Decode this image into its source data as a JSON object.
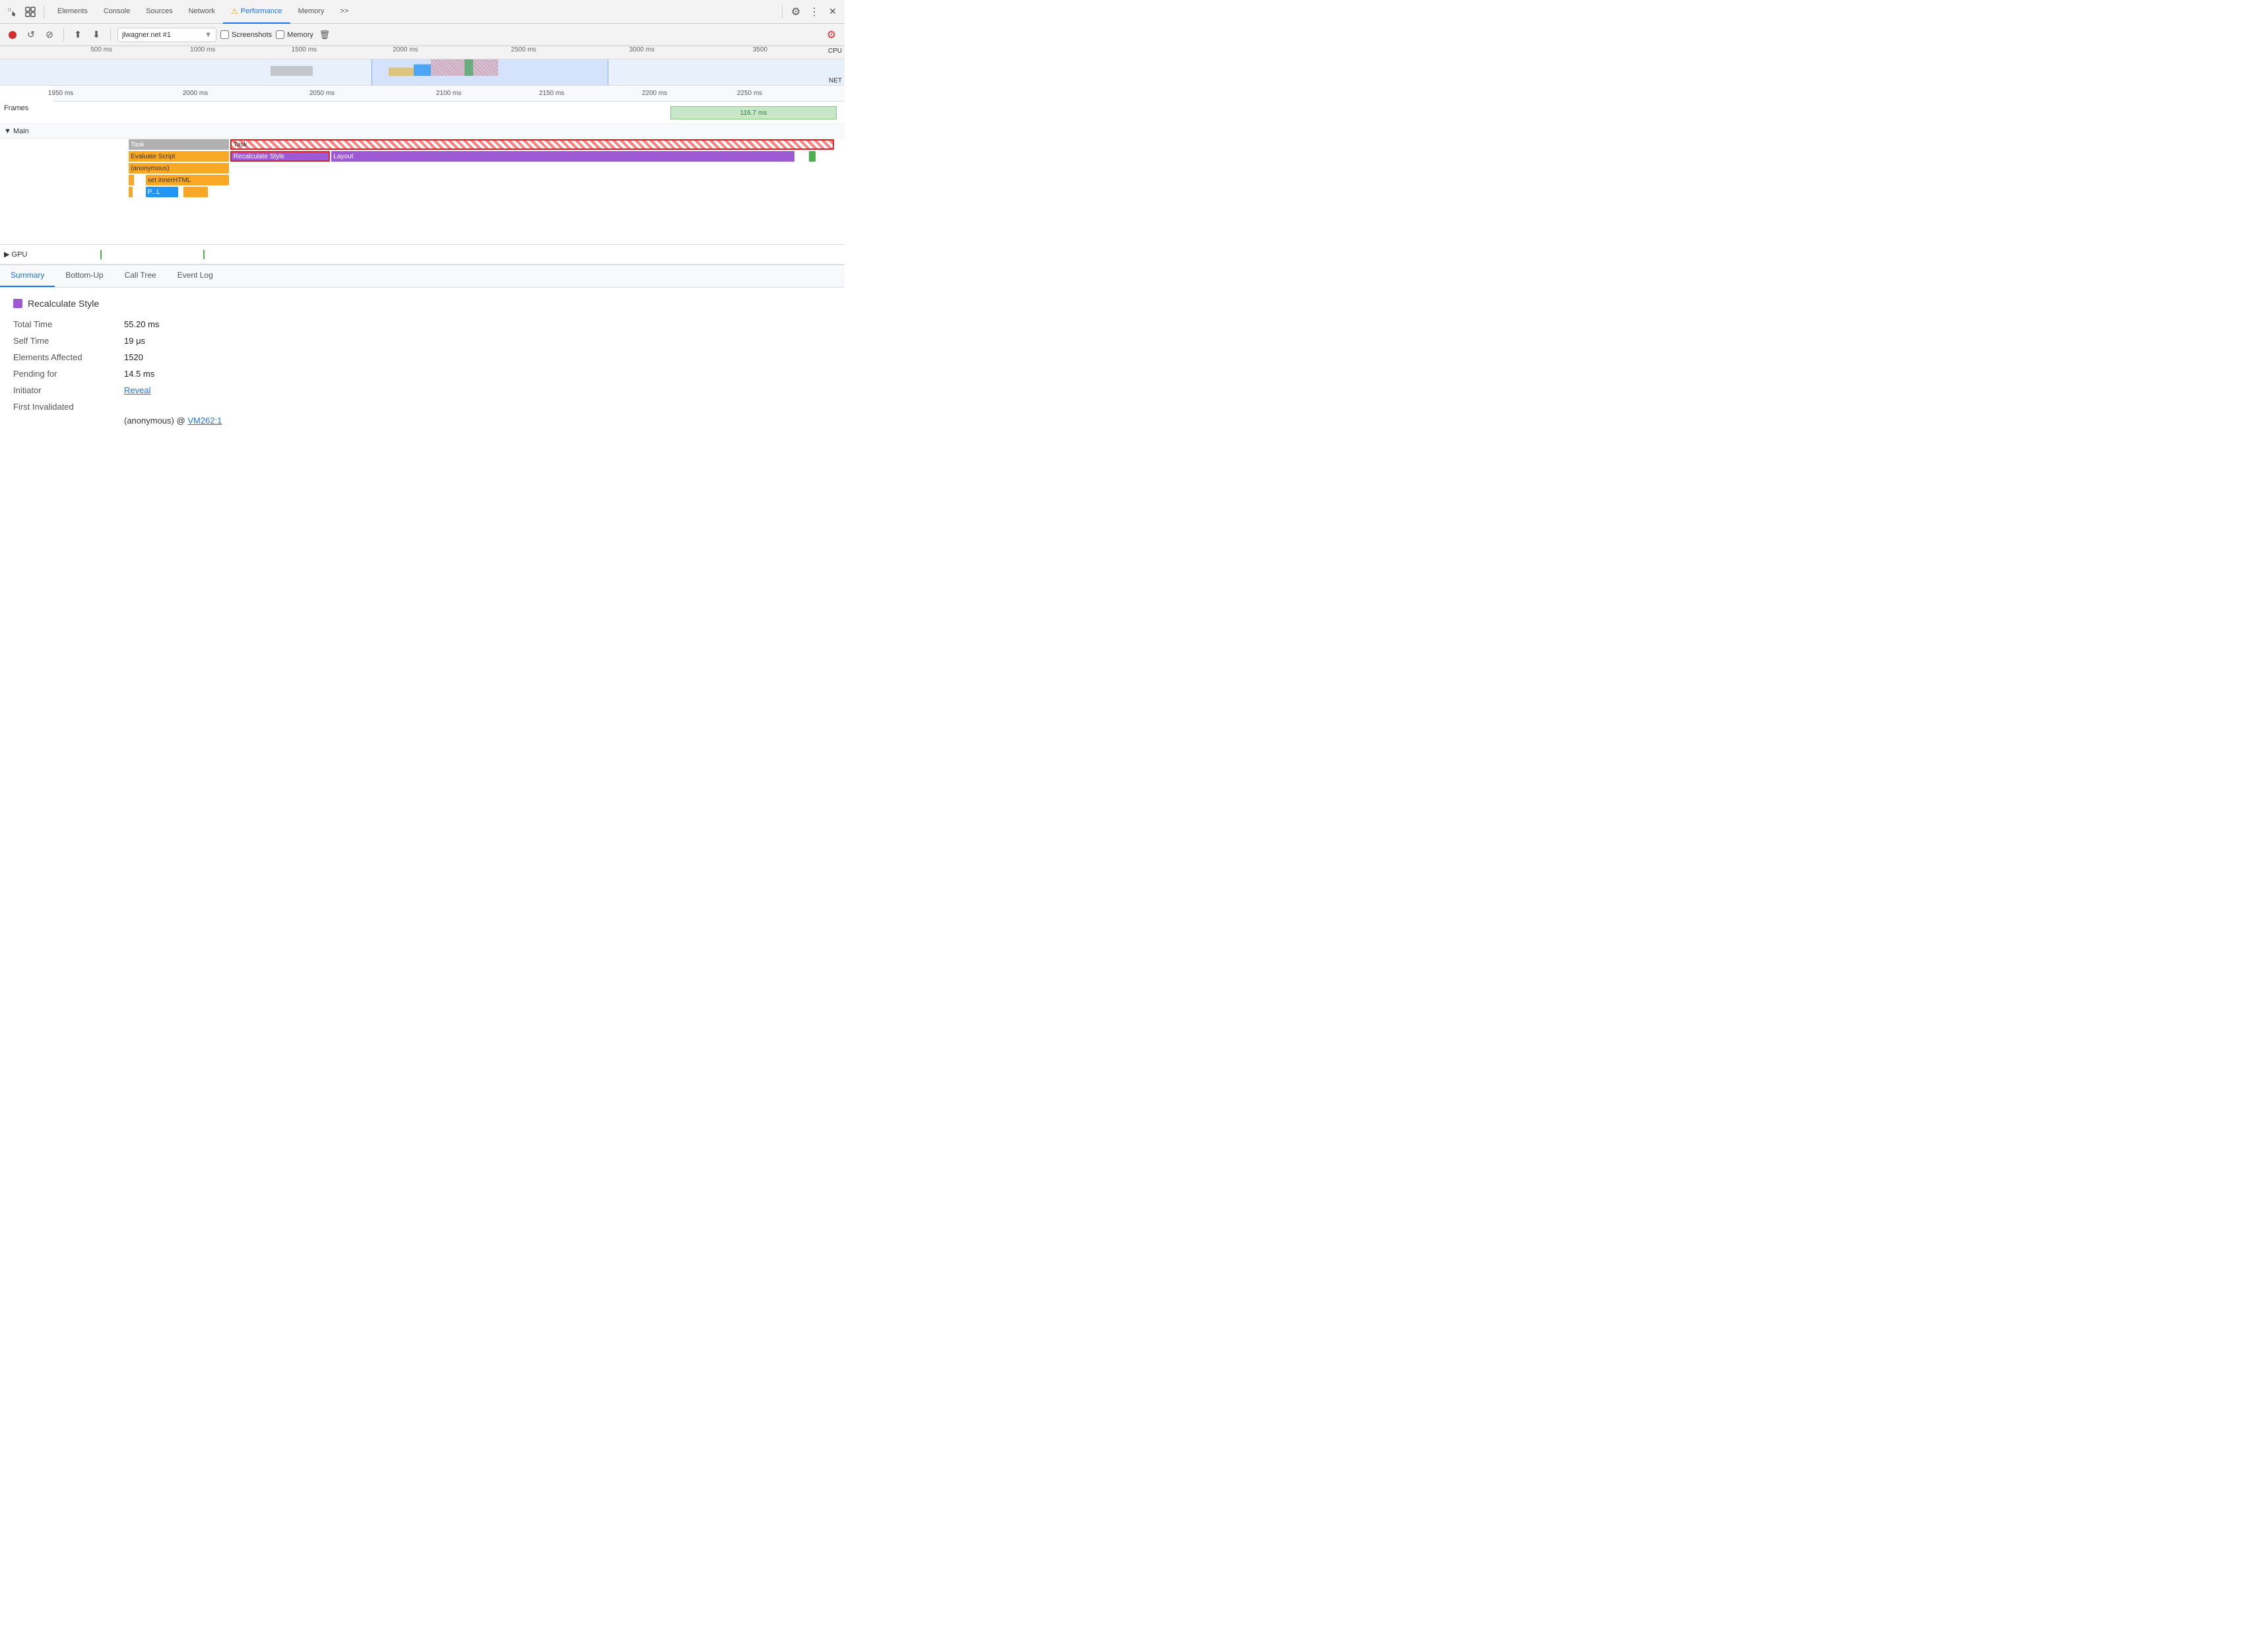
{
  "topNav": {
    "tabs": [
      {
        "id": "elements",
        "label": "Elements",
        "active": false
      },
      {
        "id": "console",
        "label": "Console",
        "active": false
      },
      {
        "id": "sources",
        "label": "Sources",
        "active": false
      },
      {
        "id": "network",
        "label": "Network",
        "active": false
      },
      {
        "id": "performance",
        "label": "Performance",
        "active": true,
        "warn": true
      },
      {
        "id": "memory",
        "label": "Memory",
        "active": false
      }
    ],
    "more_label": ">>",
    "close_label": "✕"
  },
  "perfToolbar": {
    "record_label": "⏺",
    "reload_label": "↺",
    "clear_label": "⊘",
    "upload_label": "↑",
    "download_label": "↓",
    "url": "jlwagner.net #1",
    "screenshots_label": "Screenshots",
    "memory_label": "Memory",
    "trash_label": "🗑",
    "gear_label": "⚙",
    "more_label": "⋮"
  },
  "overview": {
    "ticks": [
      {
        "label": "500 ms",
        "pct": 12
      },
      {
        "label": "1000 ms",
        "pct": 24
      },
      {
        "label": "1500 ms",
        "pct": 36
      },
      {
        "label": "2000 ms",
        "pct": 48
      },
      {
        "label": "2500 ms",
        "pct": 62
      },
      {
        "label": "3000 ms",
        "pct": 76
      },
      {
        "label": "3500",
        "pct": 90
      }
    ],
    "cpu_label": "CPU",
    "net_label": "NET",
    "selection_start_pct": 44,
    "selection_end_pct": 68
  },
  "detailRuler": {
    "ticks": [
      {
        "label": "1950 ms",
        "pct": 0
      },
      {
        "label": "2000 ms",
        "pct": 17
      },
      {
        "label": "2050 ms",
        "pct": 33
      },
      {
        "label": "2100 ms",
        "pct": 50
      },
      {
        "label": "2150 ms",
        "pct": 63
      },
      {
        "label": "2200 ms",
        "pct": 75
      },
      {
        "label": "2250 ms",
        "pct": 88
      }
    ]
  },
  "framesRow": {
    "label": "Frames",
    "bar": {
      "label": "116.7 ms",
      "left_pct": 78,
      "width_pct": 22
    }
  },
  "mainRow": {
    "label": "▼ Main",
    "rows": [
      {
        "bars": [
          {
            "label": "Task",
            "left_pct": 9,
            "width_pct": 11,
            "type": "gray"
          },
          {
            "label": "Task",
            "left_pct": 21,
            "width_pct": 72,
            "type": "gray_hatched"
          }
        ]
      },
      {
        "bars": [
          {
            "label": "Evaluate Script",
            "left_pct": 9,
            "width_pct": 12,
            "type": "yellow"
          },
          {
            "label": "Recalculate Style",
            "left_pct": 21,
            "width_pct": 12,
            "type": "purple_selected"
          },
          {
            "label": "Layout",
            "left_pct": 34,
            "width_pct": 55,
            "type": "purple"
          },
          {
            "label": "",
            "left_pct": 89.5,
            "width_pct": 1.5,
            "type": "green"
          }
        ]
      },
      {
        "bars": [
          {
            "label": "(anonymous)",
            "left_pct": 9,
            "width_pct": 12,
            "type": "yellow"
          }
        ]
      },
      {
        "bars": [
          {
            "label": "",
            "left_pct": 9,
            "width_pct": 1.5,
            "type": "yellow"
          },
          {
            "label": "set innerHTML",
            "left_pct": 11,
            "width_pct": 10,
            "type": "yellow"
          }
        ]
      },
      {
        "bars": [
          {
            "label": "",
            "left_pct": 9,
            "width_pct": 1,
            "type": "yellow"
          },
          {
            "label": "P...L",
            "left_pct": 11,
            "width_pct": 5,
            "type": "blue"
          },
          {
            "label": "",
            "left_pct": 17,
            "width_pct": 4,
            "type": "yellow"
          }
        ]
      }
    ]
  },
  "gpuRow": {
    "label": "▶ GPU",
    "ticks": [
      {
        "left_pct": 6
      },
      {
        "left_pct": 19
      }
    ]
  },
  "bottomTabs": [
    {
      "id": "summary",
      "label": "Summary",
      "active": true
    },
    {
      "id": "bottom-up",
      "label": "Bottom-Up",
      "active": false
    },
    {
      "id": "call-tree",
      "label": "Call Tree",
      "active": false
    },
    {
      "id": "event-log",
      "label": "Event Log",
      "active": false
    }
  ],
  "summary": {
    "title": "Recalculate Style",
    "swatch_color": "#9c59d1",
    "rows": [
      {
        "label": "Total Time",
        "value": "55.20 ms"
      },
      {
        "label": "Self Time",
        "value": "19 μs"
      },
      {
        "label": "Elements Affected",
        "value": "1520"
      },
      {
        "label": "Pending for",
        "value": "14.5 ms"
      },
      {
        "label": "Initiator",
        "value": "Reveal",
        "is_link": true
      }
    ],
    "first_invalidated_label": "First Invalidated",
    "first_invalidated_func": "(anonymous) @",
    "first_invalidated_link": "VM262:1"
  }
}
